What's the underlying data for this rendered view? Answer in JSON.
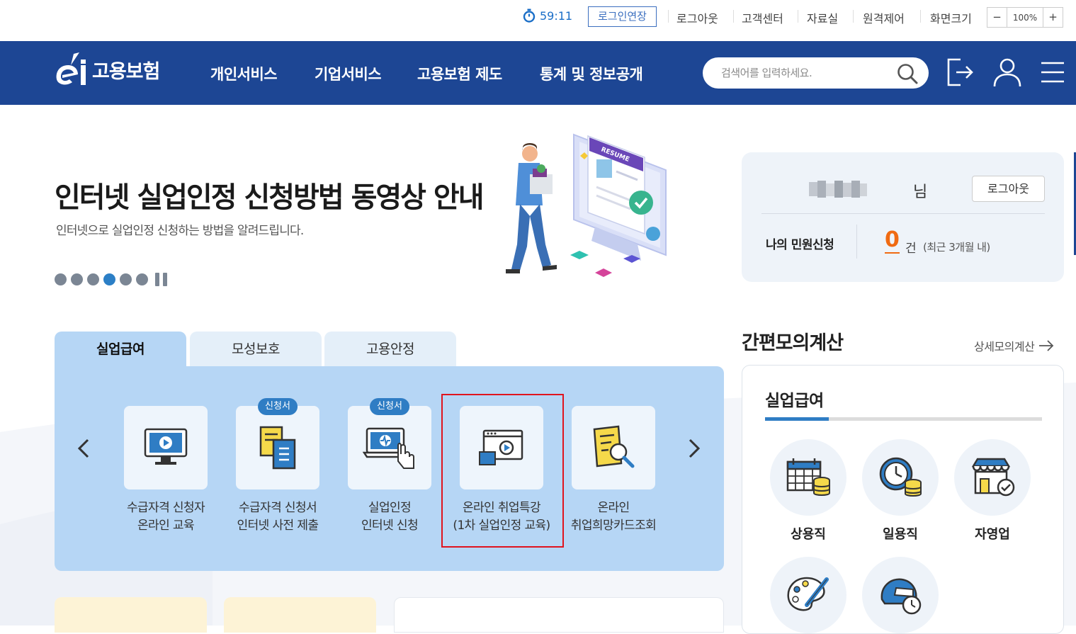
{
  "util": {
    "timer": "59:11",
    "extend": "로그인연장",
    "links": [
      "로그아웃",
      "고객센터",
      "자료실",
      "원격제어",
      "화면크기"
    ],
    "zoom_minus": "−",
    "zoom_value": "100%",
    "zoom_plus": "+"
  },
  "header": {
    "logo": "고용보험",
    "nav": [
      "개인서비스",
      "기업서비스",
      "고용보험 제도",
      "통계 및 정보공개"
    ],
    "search_placeholder": "검색어를 입력하세요.",
    "brand_color": "#1d4694"
  },
  "hero": {
    "title": "인터넷 실업인정 신청방법 동영상 안내",
    "subtitle": "인터넷으로 실업인정 신청하는 방법을 알려드립니다.",
    "illustration_label": "RESUME",
    "slide_count": 6,
    "active_slide": 4
  },
  "tabs": [
    "실업급여",
    "모성보호",
    "고용안정"
  ],
  "services": [
    {
      "label": "수급자격 신청자\n온라인 교육",
      "badge": "",
      "icon": "monitor-play-icon"
    },
    {
      "label": "수급자격 신청서\n인터넷 사전 제출",
      "badge": "신청서",
      "icon": "documents-icon"
    },
    {
      "label": "실업인정\n인터넷 신청",
      "badge": "신청서",
      "icon": "laptop-touch-icon"
    },
    {
      "label": "온라인 취업특강\n(1차 실업인정 교육)",
      "badge": "",
      "icon": "browser-video-icon"
    },
    {
      "label": "온라인\n취업희망카드조회",
      "badge": "",
      "icon": "document-search-icon"
    }
  ],
  "user": {
    "suffix": "님",
    "logout": "로그아웃",
    "civil_label": "나의 민원신청",
    "count": "0",
    "unit": "건",
    "note": "(최근 3개월 내)"
  },
  "calc": {
    "title": "간편모의계산",
    "detail_link": "상세모의계산",
    "section": "실업급여",
    "workers": [
      "상용직",
      "일용직",
      "자영업"
    ]
  }
}
